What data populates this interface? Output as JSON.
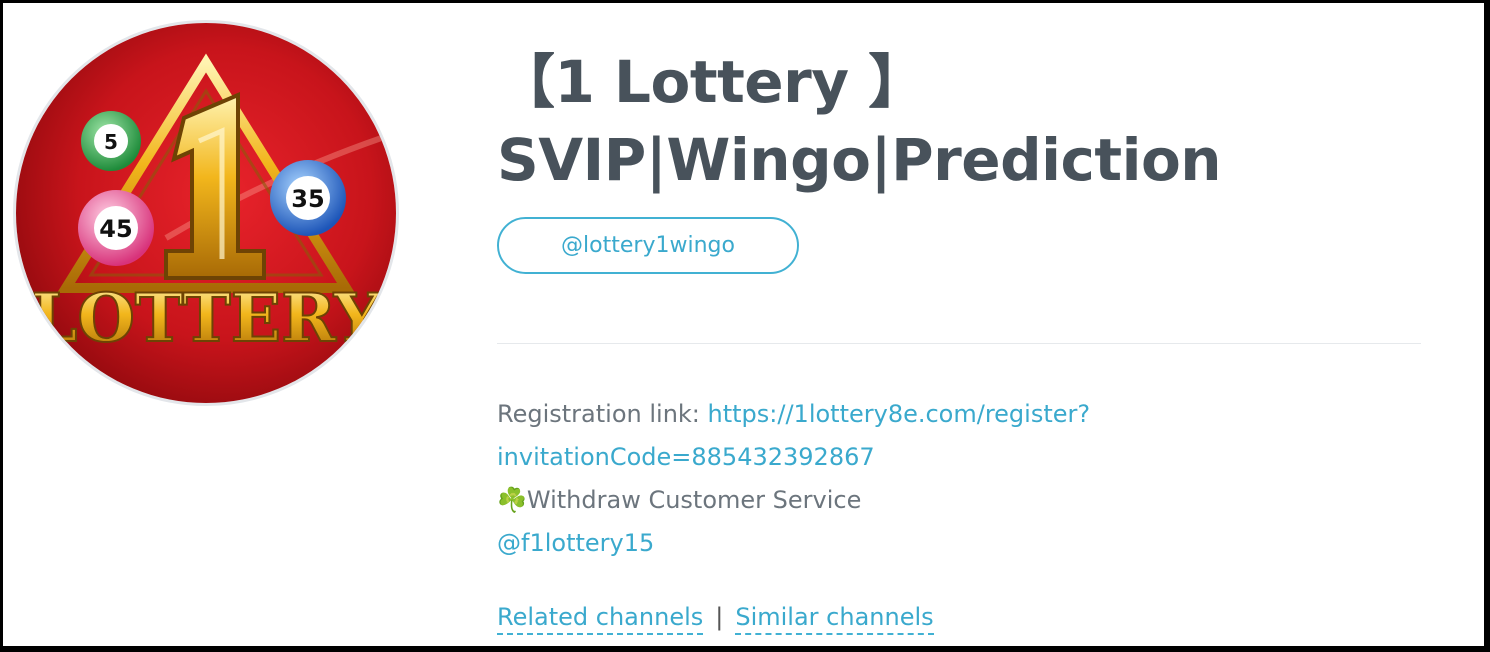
{
  "channel": {
    "title_line1": "【1 Lottery 】",
    "title_line2": "SVIP|Wingo|Prediction",
    "username": "@lottery1wingo",
    "avatar": {
      "icon": "lottery-logo-icon",
      "logo_text": "LOTTERY",
      "ball_numbers": [
        "5",
        "45",
        "35"
      ],
      "colors": {
        "background": "#c8141b",
        "gold": "#f2b61c"
      }
    }
  },
  "description": {
    "registration_label": "Registration link: ",
    "registration_link_part1": "https://1lottery8e.com/register?",
    "registration_link_part2": "invitationCode=885432392867",
    "clover_icon": "☘️",
    "service_text": "Withdraw Customer Service",
    "service_handle": "@f1lottery15"
  },
  "links": {
    "related": "Related channels",
    "separator": "|",
    "similar": "Similar channels"
  },
  "colors": {
    "accent": "#3aa9cd",
    "title": "#48525b",
    "muted": "#6c757d"
  }
}
